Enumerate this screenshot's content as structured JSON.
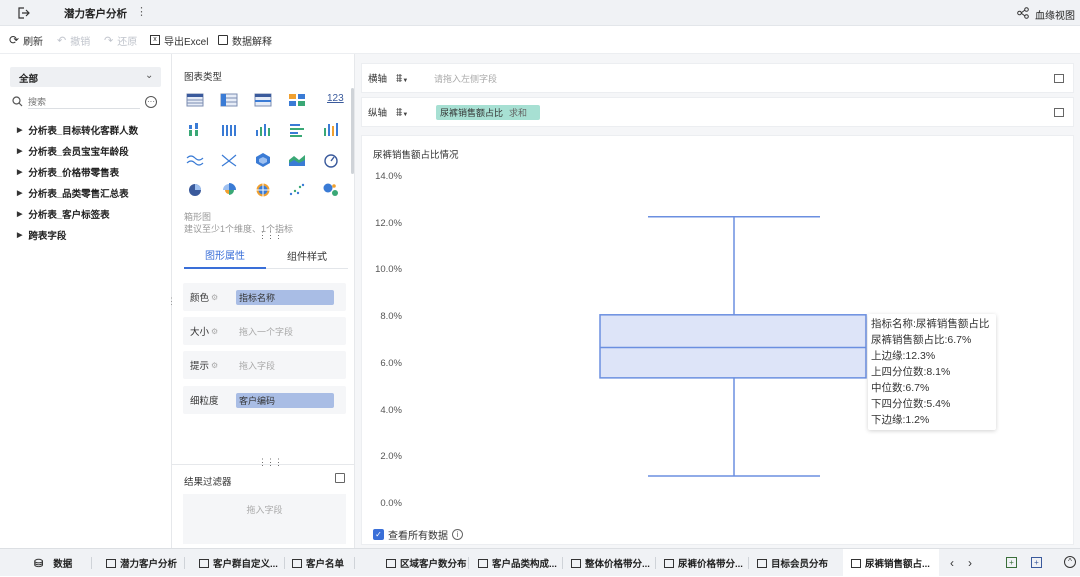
{
  "titlebar": {
    "title": "潜力客户分析",
    "lineage_label": "血缘视图"
  },
  "toolbar": {
    "refresh": "刷新",
    "undo": "撤销",
    "redo": "还原",
    "export": "导出Excel",
    "explain": "数据解释"
  },
  "left": {
    "dataset_select": "全部",
    "search_placeholder": "搜索",
    "items": [
      "分析表_目标转化客群人数",
      "分析表_会员宝宝年龄段",
      "分析表_价格带零售表",
      "分析表_品类零售汇总表",
      "分析表_客户标签表",
      "跨表字段"
    ]
  },
  "middle": {
    "chart_type_label": "图表类型",
    "number_icon": "123",
    "hint_title": "箱形图",
    "hint_desc": "建议至少1个维度、1个指标",
    "tab_graph": "图形属性",
    "tab_component": "组件样式",
    "props": [
      {
        "label": "颜色",
        "value": "指标名称",
        "placeholder": ""
      },
      {
        "label": "大小",
        "value": "",
        "placeholder": "拖入一个字段"
      },
      {
        "label": "提示",
        "value": "",
        "placeholder": "拖入字段"
      },
      {
        "label": "细粒度",
        "value": "客户编码",
        "placeholder": ""
      }
    ],
    "filter_title": "结果过滤器",
    "filter_placeholder": "拖入字段"
  },
  "axes": {
    "x_label": "横轴",
    "x_placeholder": "请拖入左侧字段",
    "y_label": "纵轴",
    "y_field": "尿裤销售额占比",
    "y_agg": "求和"
  },
  "chart_data": {
    "type": "box",
    "title": "尿裤销售额占比情况",
    "yticks": [
      "14.0%",
      "12.0%",
      "10.0%",
      "8.0%",
      "6.0%",
      "4.0%",
      "2.0%",
      "0.0%"
    ],
    "ylim": [
      0,
      14
    ],
    "series": [
      {
        "name": "尿裤销售额占比",
        "upper_whisker": 12.3,
        "q3": 8.1,
        "median": 6.7,
        "q1": 5.4,
        "lower_whisker": 1.2
      }
    ],
    "tooltip": [
      "指标名称:尿裤销售额占比",
      "尿裤销售额占比:6.7%",
      "上边缘:12.3%",
      "上四分位数:8.1%",
      "中位数:6.7%",
      "下四分位数:5.4%",
      "下边缘:1.2%"
    ],
    "box_color": "#6b8fe0",
    "box_fill": "#dde4f8"
  },
  "show_all": {
    "label": "查看所有数据",
    "checked": true
  },
  "tabs": [
    "数据",
    "潜力客户分析",
    "客户群自定义...",
    "客户名单",
    "区域客户数分布",
    "客户品类构成...",
    "整体价格带分...",
    "尿裤价格带分...",
    "目标会员分布",
    "尿裤销售额占..."
  ]
}
